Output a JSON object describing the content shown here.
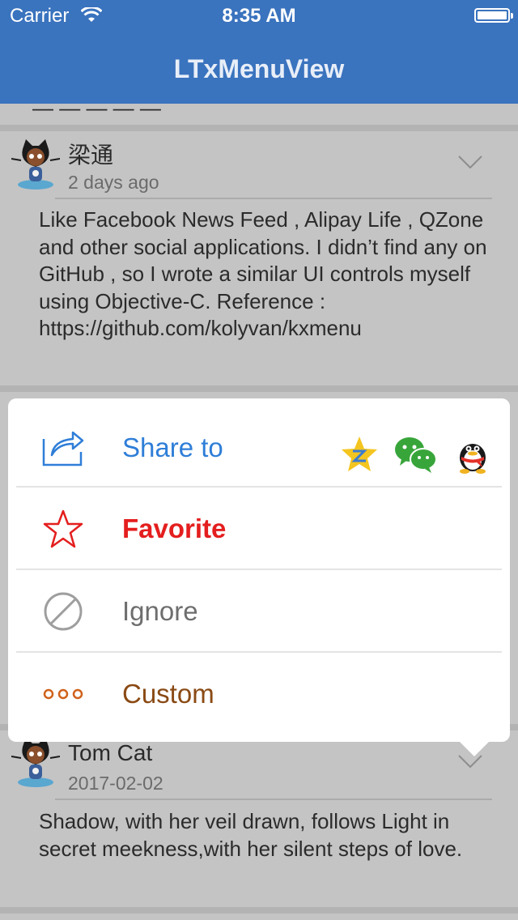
{
  "status": {
    "carrier": "Carrier",
    "time": "8:35 AM"
  },
  "nav": {
    "title": "LTxMenuView"
  },
  "feed": {
    "peek_text": "—  —  —  —  —",
    "posts": [
      {
        "author": "梁通",
        "date": "2 days ago",
        "text": "  Like Facebook News Feed , Alipay Life , QZone and other social applications. I didn’t find any on GitHub , so I wrote  a similar UI controls myself using Objective-C. Reference : https://github.com/kolyvan/kxmenu"
      },
      {
        "author": "Tom Cat",
        "date": "2017-02-02",
        "text": " Shadow, with her veil drawn, follows Light in secret meekness,with her silent steps of love."
      }
    ]
  },
  "menu": {
    "items": [
      {
        "label": "Share to",
        "icon": "share-icon",
        "color": "#2f7ed8"
      },
      {
        "label": "Favorite",
        "icon": "star-icon",
        "color": "#e41e1e"
      },
      {
        "label": "Ignore",
        "icon": "ignore-icon",
        "color": "#6e6e6e"
      },
      {
        "label": "Custom",
        "icon": "more-dots-icon",
        "color": "#8a4a14"
      }
    ],
    "share_targets": [
      "qzone-icon",
      "wechat-icon",
      "qq-icon"
    ]
  }
}
